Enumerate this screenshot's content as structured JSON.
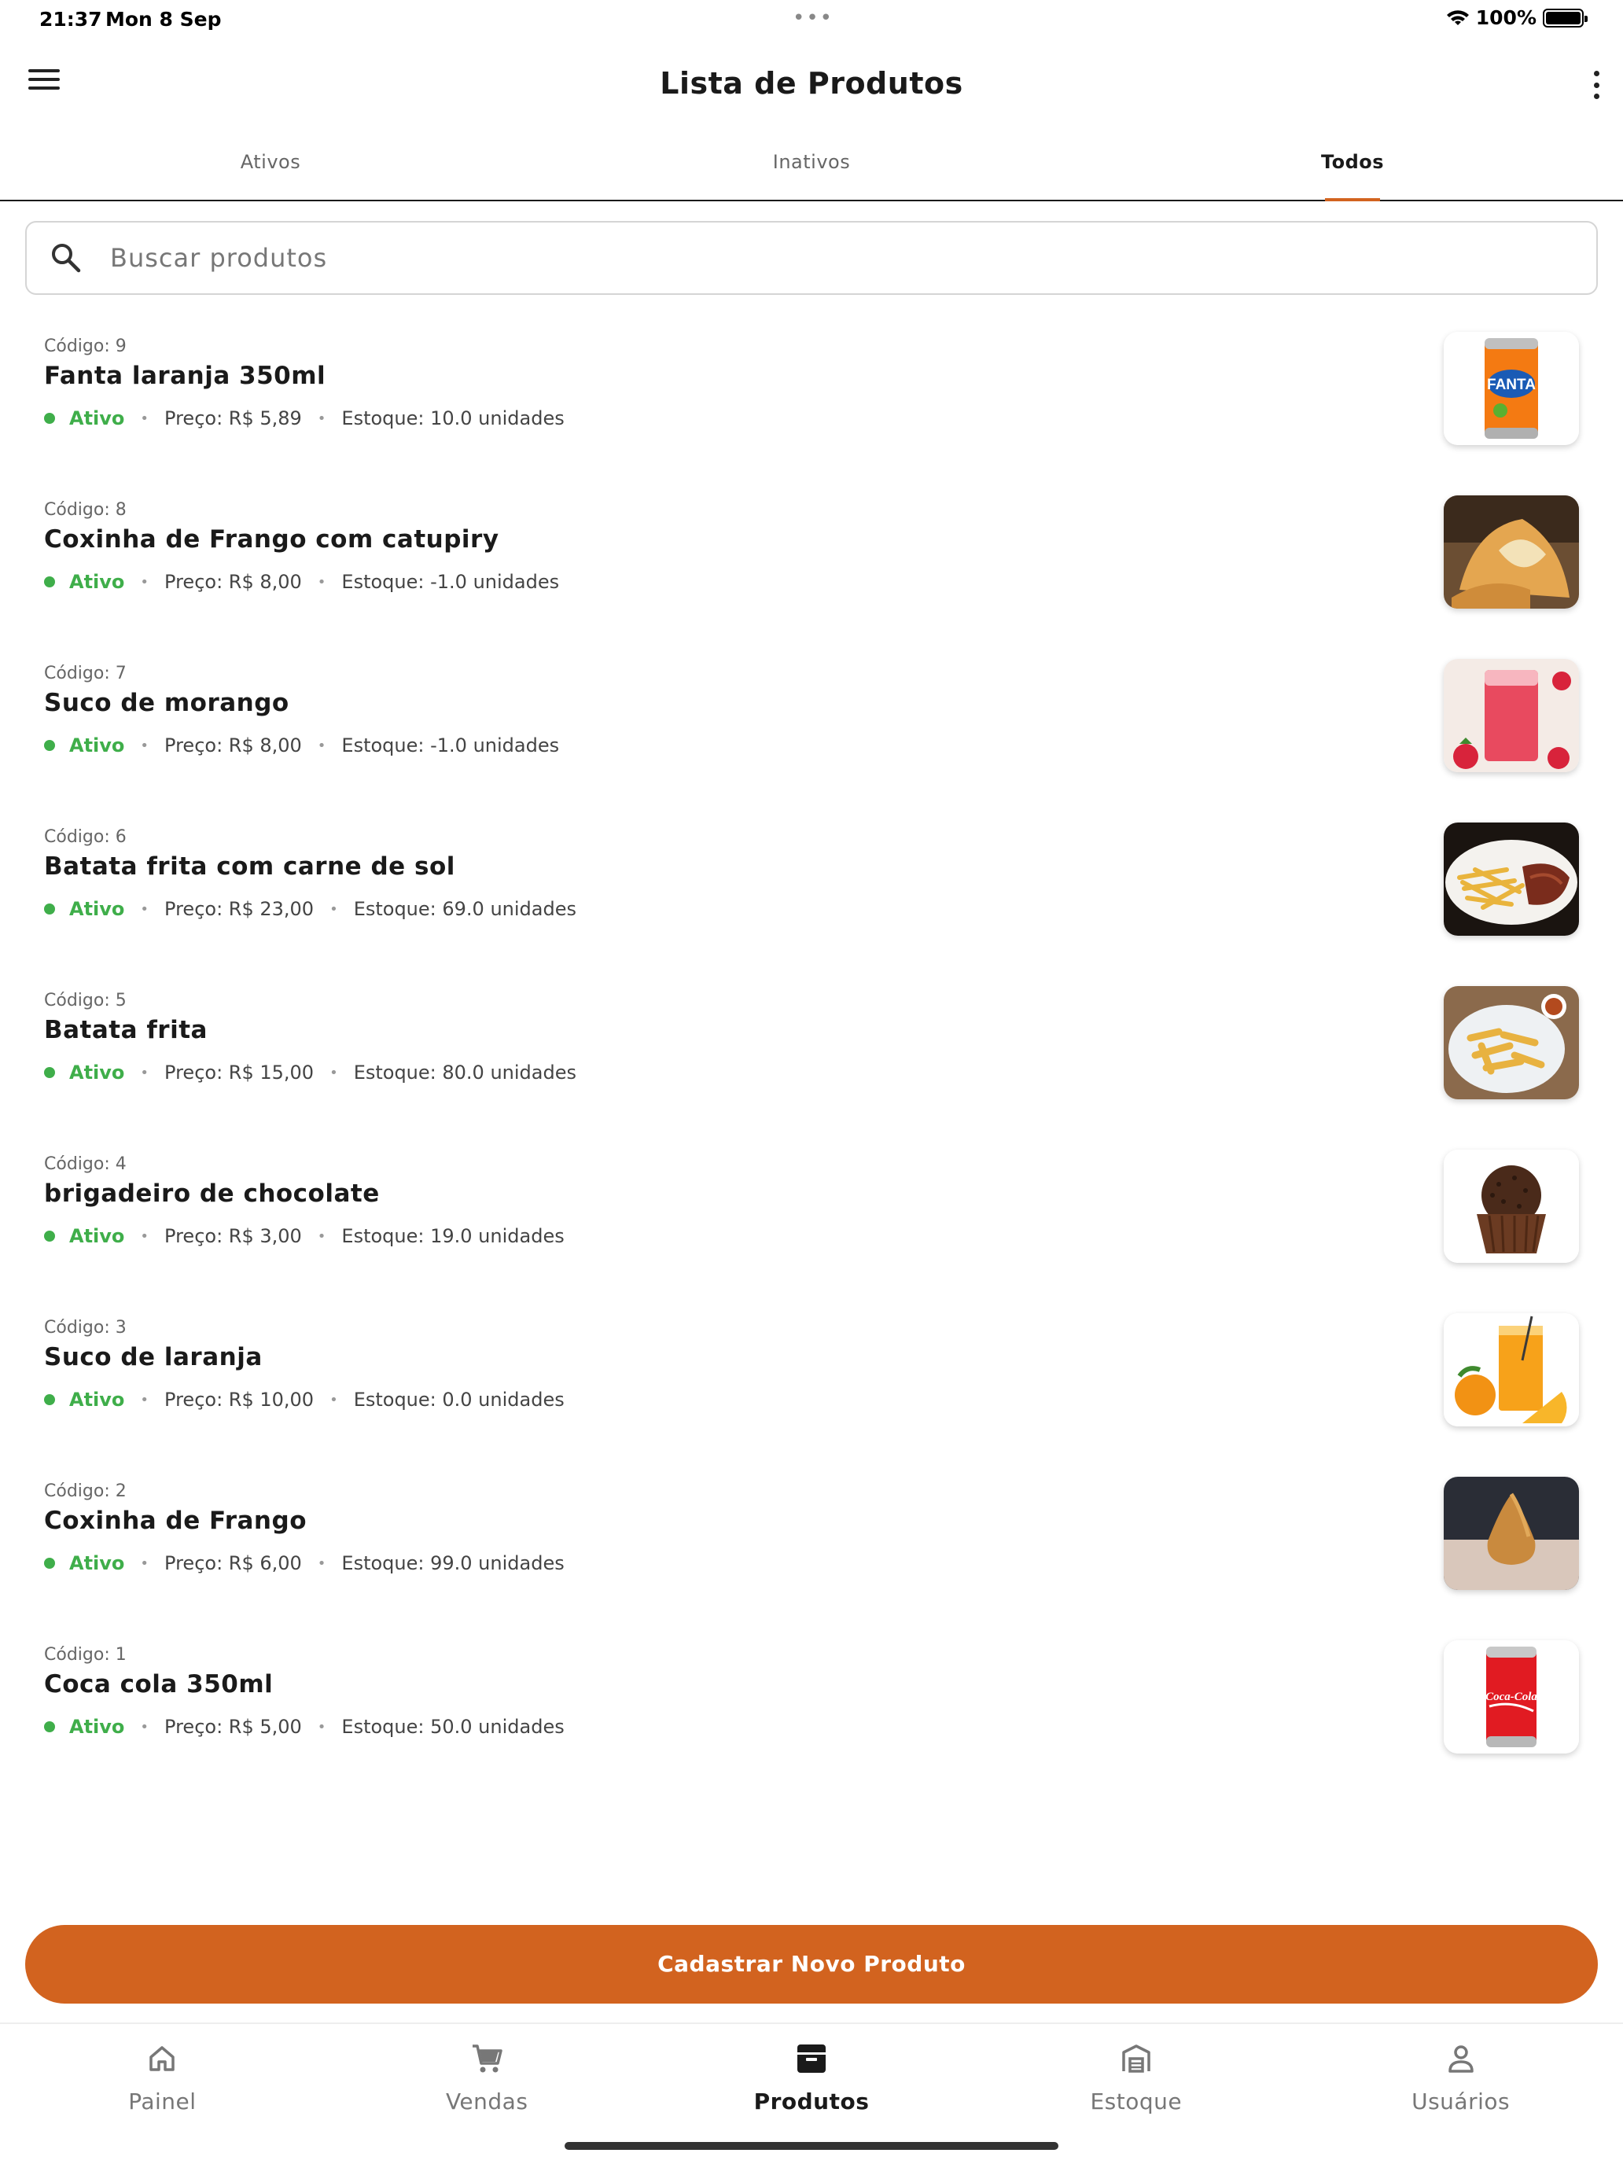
{
  "status_bar": {
    "time": "21:37",
    "date": "Mon 8 Sep",
    "battery": "100%"
  },
  "app_bar": {
    "title": "Lista de Produtos"
  },
  "tabs": [
    {
      "label": "Ativos"
    },
    {
      "label": "Inativos"
    },
    {
      "label": "Todos"
    }
  ],
  "search": {
    "placeholder": "Buscar produtos"
  },
  "products": [
    {
      "code": "Código: 9",
      "name": "Fanta laranja 350ml",
      "status": "Ativo",
      "price": "Preço: R$ 5,89",
      "stock": "Estoque: 10.0 unidades",
      "image": "fanta-can-image",
      "thumb_text": "FANTA"
    },
    {
      "code": "Código: 8",
      "name": "Coxinha de Frango com catupiry",
      "status": "Ativo",
      "price": "Preço: R$ 8,00",
      "stock": "Estoque: -1.0 unidades",
      "image": "coxinha-catupiry-image"
    },
    {
      "code": "Código: 7",
      "name": "Suco de morango",
      "status": "Ativo",
      "price": "Preço: R$ 8,00",
      "stock": "Estoque: -1.0 unidades",
      "image": "strawberry-juice-image"
    },
    {
      "code": "Código: 6",
      "name": "Batata frita com carne de sol",
      "status": "Ativo",
      "price": "Preço: R$ 23,00",
      "stock": "Estoque: 69.0 unidades",
      "image": "fries-with-beef-image"
    },
    {
      "code": "Código: 5",
      "name": "Batata frita",
      "status": "Ativo",
      "price": "Preço: R$ 15,00",
      "stock": "Estoque: 80.0 unidades",
      "image": "fries-image"
    },
    {
      "code": "Código: 4",
      "name": "brigadeiro de chocolate",
      "status": "Ativo",
      "price": "Preço: R$ 3,00",
      "stock": "Estoque: 19.0 unidades",
      "image": "brigadeiro-image"
    },
    {
      "code": "Código: 3",
      "name": "Suco de laranja",
      "status": "Ativo",
      "price": "Preço: R$ 10,00",
      "stock": "Estoque: 0.0 unidades",
      "image": "orange-juice-image"
    },
    {
      "code": "Código: 2",
      "name": "Coxinha de Frango",
      "status": "Ativo",
      "price": "Preço: R$ 6,00",
      "stock": "Estoque: 99.0 unidades",
      "image": "coxinha-image"
    },
    {
      "code": "Código: 1",
      "name": "Coca cola 350ml",
      "status": "Ativo",
      "price": "Preço: R$ 5,00",
      "stock": "Estoque: 50.0 unidades",
      "image": "coca-cola-can-image",
      "thumb_text": "Coca-Cola"
    }
  ],
  "cta": {
    "label": "Cadastrar Novo Produto"
  },
  "bottom_nav": [
    {
      "label": "Painel",
      "icon": "home-icon"
    },
    {
      "label": "Vendas",
      "icon": "cart-icon"
    },
    {
      "label": "Produtos",
      "icon": "archive-icon"
    },
    {
      "label": "Estoque",
      "icon": "warehouse-icon"
    },
    {
      "label": "Usuários",
      "icon": "user-icon"
    }
  ],
  "colors": {
    "accent": "#d2631f",
    "status_active": "#3fae4a",
    "text": "#1a1a1a"
  }
}
